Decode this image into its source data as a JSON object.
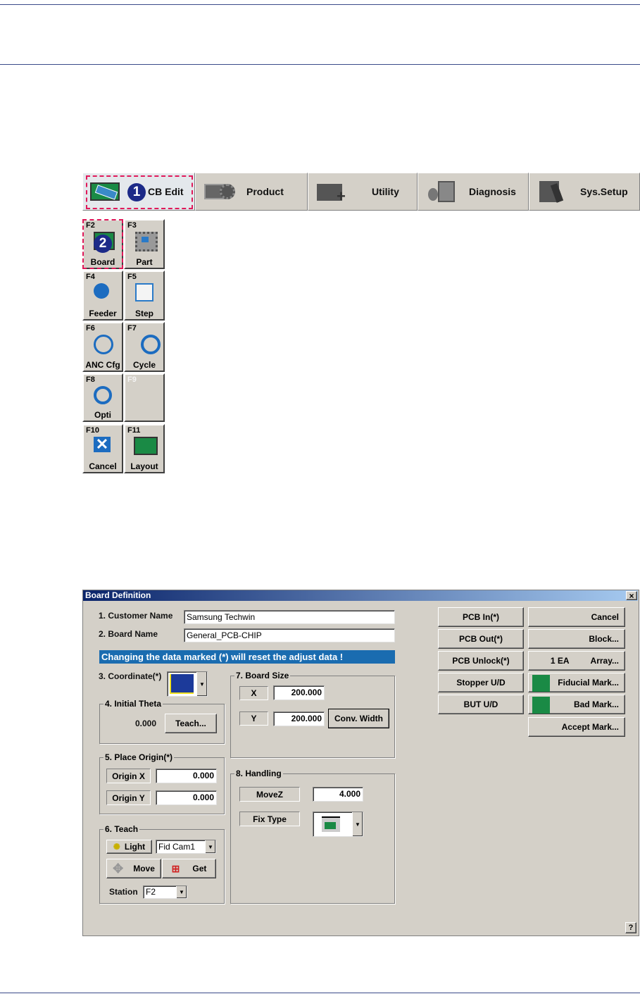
{
  "toolbar": {
    "tabs": [
      {
        "label": "CB Edit",
        "icon": "pcb-edit-icon"
      },
      {
        "label": "Product",
        "icon": "product-gear-icon"
      },
      {
        "label": "Utility",
        "icon": "utility-folder-icon"
      },
      {
        "label": "Diagnosis",
        "icon": "diagnosis-icon"
      },
      {
        "label": "Sys.Setup",
        "icon": "sys-setup-icon"
      }
    ]
  },
  "callouts": [
    "1",
    "2"
  ],
  "fkeys": [
    {
      "key": "F2",
      "label": "Board"
    },
    {
      "key": "F3",
      "label": "Part"
    },
    {
      "key": "F4",
      "label": "Feeder"
    },
    {
      "key": "F5",
      "label": "Step"
    },
    {
      "key": "F6",
      "label": "ANC Cfg"
    },
    {
      "key": "F7",
      "label": "Cycle"
    },
    {
      "key": "F8",
      "label": "Opti"
    },
    {
      "key": "F9",
      "label": ""
    },
    {
      "key": "F10",
      "label": "Cancel"
    },
    {
      "key": "F11",
      "label": "Layout"
    }
  ],
  "dialog": {
    "title": "Board Definition",
    "close": "×",
    "help": "?",
    "customer_label": "1. Customer Name",
    "customer_value": "Samsung Techwin",
    "board_label": "2. Board Name",
    "board_value": "General_PCB-CHIP",
    "warning": "Changing the data marked (*) will reset the adjust data !",
    "coord_label": "3. Coordinate(*)",
    "theta": {
      "title": "4. Initial Theta",
      "value": "0.000",
      "teach": "Teach..."
    },
    "origin": {
      "title": "5. Place Origin(*)",
      "x_label": "Origin X",
      "x_value": "0.000",
      "y_label": "Origin Y",
      "y_value": "0.000"
    },
    "teach": {
      "title": "6. Teach",
      "light": "Light",
      "camera": "Fid Cam1",
      "move": "Move",
      "get": "Get",
      "station_label": "Station",
      "station": "F2"
    },
    "size": {
      "title": "7. Board Size",
      "x_label": "X",
      "x_value": "200.000",
      "y_label": "Y",
      "y_value": "200.000",
      "conv": "Conv. Width"
    },
    "handling": {
      "title": "8. Handling",
      "movez_label": "MoveZ",
      "movez_value": "4.000",
      "fix_label": "Fix Type"
    },
    "buttons": {
      "pcb_in": "PCB In(*)",
      "pcb_out": "PCB Out(*)",
      "pcb_unlock": "PCB Unlock(*)",
      "stopper": "Stopper U/D",
      "but": "BUT U/D",
      "cancel": "Cancel",
      "block": "Block...",
      "array_count": "1 EA",
      "array": "Array...",
      "fiducial": "Fiducial Mark...",
      "bad": "Bad Mark...",
      "accept": "Accept Mark..."
    }
  }
}
